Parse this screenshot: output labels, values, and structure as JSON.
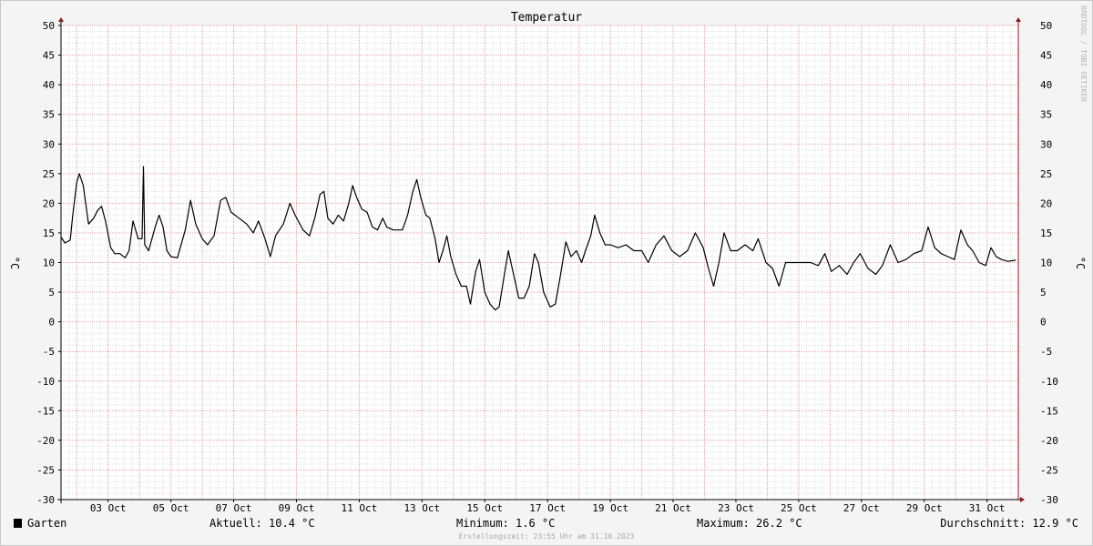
{
  "watermark": "RRDTOOL / TOBI OETIKER",
  "chart_data": {
    "type": "line",
    "title": "Temperatur",
    "ylabel": "°C",
    "ylim": [
      -30,
      50
    ],
    "yticks": [
      -30,
      -25,
      -20,
      -15,
      -10,
      -5,
      0,
      5,
      10,
      15,
      20,
      25,
      30,
      35,
      40,
      45,
      50
    ],
    "xlim": [
      "2023-10-01T12:00",
      "2023-10-31T23:55"
    ],
    "xticks": [
      {
        "x": "2023-10-03T00:00",
        "label": "03 Oct"
      },
      {
        "x": "2023-10-05T00:00",
        "label": "05 Oct"
      },
      {
        "x": "2023-10-07T00:00",
        "label": "07 Oct"
      },
      {
        "x": "2023-10-09T00:00",
        "label": "09 Oct"
      },
      {
        "x": "2023-10-11T00:00",
        "label": "11 Oct"
      },
      {
        "x": "2023-10-13T00:00",
        "label": "13 Oct"
      },
      {
        "x": "2023-10-15T00:00",
        "label": "15 Oct"
      },
      {
        "x": "2023-10-17T00:00",
        "label": "17 Oct"
      },
      {
        "x": "2023-10-19T00:00",
        "label": "19 Oct"
      },
      {
        "x": "2023-10-21T00:00",
        "label": "21 Oct"
      },
      {
        "x": "2023-10-23T00:00",
        "label": "23 Oct"
      },
      {
        "x": "2023-10-25T00:00",
        "label": "25 Oct"
      },
      {
        "x": "2023-10-27T00:00",
        "label": "27 Oct"
      },
      {
        "x": "2023-10-29T00:00",
        "label": "29 Oct"
      },
      {
        "x": "2023-10-31T00:00",
        "label": "31 Oct"
      }
    ],
    "grid": true,
    "series": [
      {
        "name": "Garten",
        "color": "#000000",
        "points": [
          [
            "2023-10-01T12:00",
            14.3
          ],
          [
            "2023-10-01T15:00",
            13.3
          ],
          [
            "2023-10-01T19:00",
            13.8
          ],
          [
            "2023-10-01T21:00",
            18.0
          ],
          [
            "2023-10-02T00:00",
            23.5
          ],
          [
            "2023-10-02T02:00",
            25.0
          ],
          [
            "2023-10-02T05:00",
            23.0
          ],
          [
            "2023-10-02T09:00",
            16.5
          ],
          [
            "2023-10-02T13:00",
            17.5
          ],
          [
            "2023-10-02T16:00",
            18.8
          ],
          [
            "2023-10-02T19:00",
            19.5
          ],
          [
            "2023-10-02T22:00",
            17.0
          ],
          [
            "2023-10-03T02:00",
            12.5
          ],
          [
            "2023-10-03T05:00",
            11.5
          ],
          [
            "2023-10-03T09:00",
            11.5
          ],
          [
            "2023-10-03T13:00",
            10.8
          ],
          [
            "2023-10-03T16:00",
            12.0
          ],
          [
            "2023-10-03T19:00",
            17.0
          ],
          [
            "2023-10-03T23:00",
            14.0
          ],
          [
            "2023-10-04T02:00",
            14.0
          ],
          [
            "2023-10-04T03:00",
            26.2
          ],
          [
            "2023-10-04T04:00",
            13.0
          ],
          [
            "2023-10-04T07:00",
            12.0
          ],
          [
            "2023-10-04T12:00",
            16.0
          ],
          [
            "2023-10-04T15:00",
            18.0
          ],
          [
            "2023-10-04T18:00",
            16.0
          ],
          [
            "2023-10-04T21:00",
            12.0
          ],
          [
            "2023-10-05T00:00",
            11.0
          ],
          [
            "2023-10-05T05:00",
            10.8
          ],
          [
            "2023-10-05T11:00",
            15.5
          ],
          [
            "2023-10-05T15:00",
            20.5
          ],
          [
            "2023-10-05T19:00",
            16.5
          ],
          [
            "2023-10-06T00:00",
            14.0
          ],
          [
            "2023-10-06T04:00",
            13.0
          ],
          [
            "2023-10-06T09:00",
            14.5
          ],
          [
            "2023-10-06T14:00",
            20.5
          ],
          [
            "2023-10-06T18:00",
            21.0
          ],
          [
            "2023-10-06T22:00",
            18.5
          ],
          [
            "2023-10-07T04:00",
            17.5
          ],
          [
            "2023-10-07T10:00",
            16.5
          ],
          [
            "2023-10-07T15:00",
            15.0
          ],
          [
            "2023-10-07T19:00",
            17.0
          ],
          [
            "2023-10-08T00:00",
            14.0
          ],
          [
            "2023-10-08T04:00",
            11.0
          ],
          [
            "2023-10-08T08:00",
            14.5
          ],
          [
            "2023-10-08T14:00",
            16.5
          ],
          [
            "2023-10-08T19:00",
            20.0
          ],
          [
            "2023-10-08T23:00",
            18.0
          ],
          [
            "2023-10-09T05:00",
            15.5
          ],
          [
            "2023-10-09T10:00",
            14.5
          ],
          [
            "2023-10-09T14:00",
            17.5
          ],
          [
            "2023-10-09T18:00",
            21.5
          ],
          [
            "2023-10-09T21:00",
            22.0
          ],
          [
            "2023-10-10T00:00",
            17.5
          ],
          [
            "2023-10-10T04:00",
            16.5
          ],
          [
            "2023-10-10T08:00",
            18.0
          ],
          [
            "2023-10-10T12:00",
            17.0
          ],
          [
            "2023-10-10T16:00",
            20.0
          ],
          [
            "2023-10-10T19:00",
            23.0
          ],
          [
            "2023-10-10T22:00",
            21.0
          ],
          [
            "2023-10-11T02:00",
            19.0
          ],
          [
            "2023-10-11T06:00",
            18.5
          ],
          [
            "2023-10-11T10:00",
            16.0
          ],
          [
            "2023-10-11T14:00",
            15.5
          ],
          [
            "2023-10-11T18:00",
            17.5
          ],
          [
            "2023-10-11T21:00",
            16.0
          ],
          [
            "2023-10-12T02:00",
            15.5
          ],
          [
            "2023-10-12T06:00",
            15.5
          ],
          [
            "2023-10-12T09:00",
            15.5
          ],
          [
            "2023-10-12T13:00",
            18.0
          ],
          [
            "2023-10-12T17:00",
            22.0
          ],
          [
            "2023-10-12T20:00",
            24.0
          ],
          [
            "2023-10-12T23:00",
            21.0
          ],
          [
            "2023-10-13T03:00",
            18.0
          ],
          [
            "2023-10-13T06:00",
            17.5
          ],
          [
            "2023-10-13T10:00",
            14.0
          ],
          [
            "2023-10-13T13:00",
            10.0
          ],
          [
            "2023-10-13T16:00",
            12.0
          ],
          [
            "2023-10-13T19:00",
            14.5
          ],
          [
            "2023-10-13T22:00",
            11.0
          ],
          [
            "2023-10-14T02:00",
            8.0
          ],
          [
            "2023-10-14T06:00",
            6.0
          ],
          [
            "2023-10-14T10:00",
            6.0
          ],
          [
            "2023-10-14T13:00",
            3.0
          ],
          [
            "2023-10-14T17:00",
            8.5
          ],
          [
            "2023-10-14T20:00",
            10.5
          ],
          [
            "2023-10-15T00:00",
            5.0
          ],
          [
            "2023-10-15T04:00",
            3.0
          ],
          [
            "2023-10-15T08:00",
            2.0
          ],
          [
            "2023-10-15T11:00",
            2.5
          ],
          [
            "2023-10-15T15:00",
            8.0
          ],
          [
            "2023-10-15T18:00",
            12.0
          ],
          [
            "2023-10-15T21:00",
            9.0
          ],
          [
            "2023-10-16T02:00",
            4.0
          ],
          [
            "2023-10-16T06:00",
            4.0
          ],
          [
            "2023-10-16T10:00",
            6.0
          ],
          [
            "2023-10-16T14:00",
            11.5
          ],
          [
            "2023-10-16T17:00",
            10.0
          ],
          [
            "2023-10-16T21:00",
            5.0
          ],
          [
            "2023-10-17T02:00",
            2.5
          ],
          [
            "2023-10-17T06:00",
            3.0
          ],
          [
            "2023-10-17T10:00",
            8.0
          ],
          [
            "2023-10-17T14:00",
            13.5
          ],
          [
            "2023-10-17T18:00",
            11.0
          ],
          [
            "2023-10-17T22:00",
            12.0
          ],
          [
            "2023-10-18T02:00",
            10.0
          ],
          [
            "2023-10-18T05:00",
            12.0
          ],
          [
            "2023-10-18T09:00",
            14.5
          ],
          [
            "2023-10-18T12:00",
            18.0
          ],
          [
            "2023-10-18T16:00",
            15.0
          ],
          [
            "2023-10-18T20:00",
            13.0
          ],
          [
            "2023-10-19T00:00",
            13.0
          ],
          [
            "2023-10-19T06:00",
            12.5
          ],
          [
            "2023-10-19T12:00",
            13.0
          ],
          [
            "2023-10-19T18:00",
            12.0
          ],
          [
            "2023-10-20T00:00",
            12.0
          ],
          [
            "2023-10-20T05:00",
            10.0
          ],
          [
            "2023-10-20T11:00",
            13.0
          ],
          [
            "2023-10-20T17:00",
            14.5
          ],
          [
            "2023-10-20T23:00",
            12.0
          ],
          [
            "2023-10-21T05:00",
            11.0
          ],
          [
            "2023-10-21T11:00",
            12.0
          ],
          [
            "2023-10-21T17:00",
            15.0
          ],
          [
            "2023-10-21T23:00",
            12.5
          ],
          [
            "2023-10-22T03:00",
            9.0
          ],
          [
            "2023-10-22T07:00",
            6.0
          ],
          [
            "2023-10-22T11:00",
            10.0
          ],
          [
            "2023-10-22T15:00",
            15.0
          ],
          [
            "2023-10-22T20:00",
            12.0
          ],
          [
            "2023-10-23T01:00",
            12.0
          ],
          [
            "2023-10-23T07:00",
            13.0
          ],
          [
            "2023-10-23T13:00",
            12.0
          ],
          [
            "2023-10-23T17:00",
            14.0
          ],
          [
            "2023-10-23T23:00",
            10.0
          ],
          [
            "2023-10-24T04:00",
            9.0
          ],
          [
            "2023-10-24T09:00",
            6.0
          ],
          [
            "2023-10-24T14:00",
            10.0
          ],
          [
            "2023-10-24T20:00",
            10.0
          ],
          [
            "2023-10-25T03:00",
            10.0
          ],
          [
            "2023-10-25T09:00",
            10.0
          ],
          [
            "2023-10-25T15:00",
            9.5
          ],
          [
            "2023-10-25T20:00",
            11.5
          ],
          [
            "2023-10-26T01:00",
            8.5
          ],
          [
            "2023-10-26T07:00",
            9.5
          ],
          [
            "2023-10-26T13:00",
            8.0
          ],
          [
            "2023-10-26T18:00",
            10.0
          ],
          [
            "2023-10-26T23:00",
            11.5
          ],
          [
            "2023-10-27T05:00",
            9.0
          ],
          [
            "2023-10-27T11:00",
            8.0
          ],
          [
            "2023-10-27T16:00",
            9.5
          ],
          [
            "2023-10-27T22:00",
            13.0
          ],
          [
            "2023-10-28T04:00",
            10.0
          ],
          [
            "2023-10-28T10:00",
            10.5
          ],
          [
            "2023-10-28T16:00",
            11.5
          ],
          [
            "2023-10-28T22:00",
            12.0
          ],
          [
            "2023-10-29T03:00",
            16.0
          ],
          [
            "2023-10-29T08:00",
            12.5
          ],
          [
            "2023-10-29T13:00",
            11.5
          ],
          [
            "2023-10-29T18:00",
            11.0
          ],
          [
            "2023-10-29T23:00",
            10.5
          ],
          [
            "2023-10-30T04:00",
            15.5
          ],
          [
            "2023-10-30T09:00",
            13.0
          ],
          [
            "2023-10-30T13:00",
            12.0
          ],
          [
            "2023-10-30T18:00",
            10.0
          ],
          [
            "2023-10-30T23:00",
            9.5
          ],
          [
            "2023-10-31T03:00",
            12.5
          ],
          [
            "2023-10-31T07:00",
            11.0
          ],
          [
            "2023-10-31T11:00",
            10.5
          ],
          [
            "2023-10-31T16:00",
            10.2
          ],
          [
            "2023-10-31T22:00",
            10.4
          ]
        ]
      }
    ]
  },
  "legend": {
    "series_name": "Garten",
    "current": "Aktuell: 10.4 °C",
    "minimum": "Minimum: 1.6 °C",
    "maximum": "Maximum: 26.2 °C",
    "average": "Durchschnitt: 12.9 °C"
  },
  "footer": "Erstellungszeit: 23:55 Uhr am 31.10.2023"
}
